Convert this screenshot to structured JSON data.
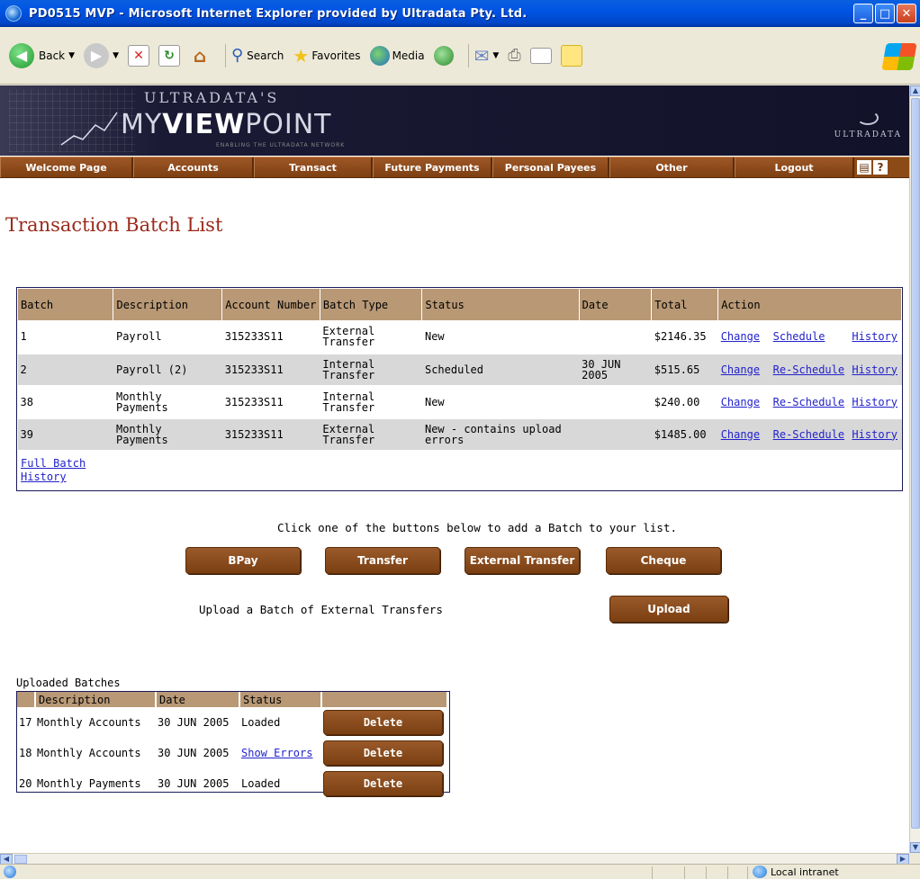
{
  "window": {
    "title": "PD0515 MVP - Microsoft Internet Explorer provided by Ultradata Pty. Ltd."
  },
  "toolbar": {
    "back_label": "Back",
    "search_label": "Search",
    "favorites_label": "Favorites",
    "media_label": "Media"
  },
  "banner": {
    "ultradatas": "ULTRADATA'S",
    "my": "MY",
    "view": "VIEW",
    "point": "POINT",
    "tagline": "ENABLING THE ULTRADATA NETWORK",
    "brand": "ULTRADATA"
  },
  "nav": {
    "items": [
      "Welcome Page",
      "Accounts",
      "Transact",
      "Future Payments",
      "Personal Payees",
      "Other",
      "Logout"
    ]
  },
  "page": {
    "title": "Transaction Batch List"
  },
  "batches": {
    "headers": [
      "Batch",
      "Description",
      "Account Number",
      "Batch Type",
      "Status",
      "Date",
      "Total",
      "Action"
    ],
    "rows": [
      {
        "batch": "1",
        "description": "Payroll",
        "account": "315233S11",
        "type": "External Transfer",
        "status": "New",
        "date": "",
        "total": "$2146.35",
        "change": "Change",
        "schedule": "Schedule",
        "history": "History"
      },
      {
        "batch": "2",
        "description": "Payroll (2)",
        "account": "315233S11",
        "type": "Internal Transfer",
        "status": "Scheduled",
        "date": "30 JUN 2005",
        "total": "$515.65",
        "change": "Change",
        "schedule": "Re-Schedule",
        "history": "History"
      },
      {
        "batch": "38",
        "description": "Monthly Payments",
        "account": "315233S11",
        "type": "Internal Transfer",
        "status": "New",
        "date": "",
        "total": "$240.00",
        "change": "Change",
        "schedule": "Re-Schedule",
        "history": "History"
      },
      {
        "batch": "39",
        "description": "Monthly Payments",
        "account": "315233S11",
        "type": "External Transfer",
        "status": "New - contains upload errors",
        "date": "",
        "total": "$1485.00",
        "change": "Change",
        "schedule": "Re-Schedule",
        "history": "History"
      }
    ],
    "full_history_link": "Full Batch History"
  },
  "add": {
    "instruction": "Click one of the buttons below to add a Batch to your list.",
    "bpay": "BPay",
    "transfer": "Transfer",
    "external_transfer": "External Transfer",
    "cheque": "Cheque",
    "upload_label": "Upload a Batch of External Transfers",
    "upload": "Upload"
  },
  "uploaded": {
    "label": "Uploaded Batches",
    "headers": [
      "Description",
      "Date",
      "Status"
    ],
    "rows": [
      {
        "num": "17",
        "description": "Monthly Accounts",
        "date": "30 JUN 2005",
        "status": "Loaded",
        "status_link": false,
        "delete": "Delete"
      },
      {
        "num": "18",
        "description": "Monthly Accounts",
        "date": "30 JUN 2005",
        "status": "Show Errors",
        "status_link": true,
        "delete": "Delete"
      },
      {
        "num": "20",
        "description": "Monthly Payments",
        "date": "30 JUN 2005",
        "status": "Loaded",
        "status_link": false,
        "delete": "Delete"
      }
    ]
  },
  "statusbar": {
    "zone": "Local intranet"
  },
  "colors": {
    "nav_brown": "#8c4a17",
    "header_tan": "#b89875",
    "title_red": "#9a2a1a",
    "link_blue": "#2222cc"
  }
}
